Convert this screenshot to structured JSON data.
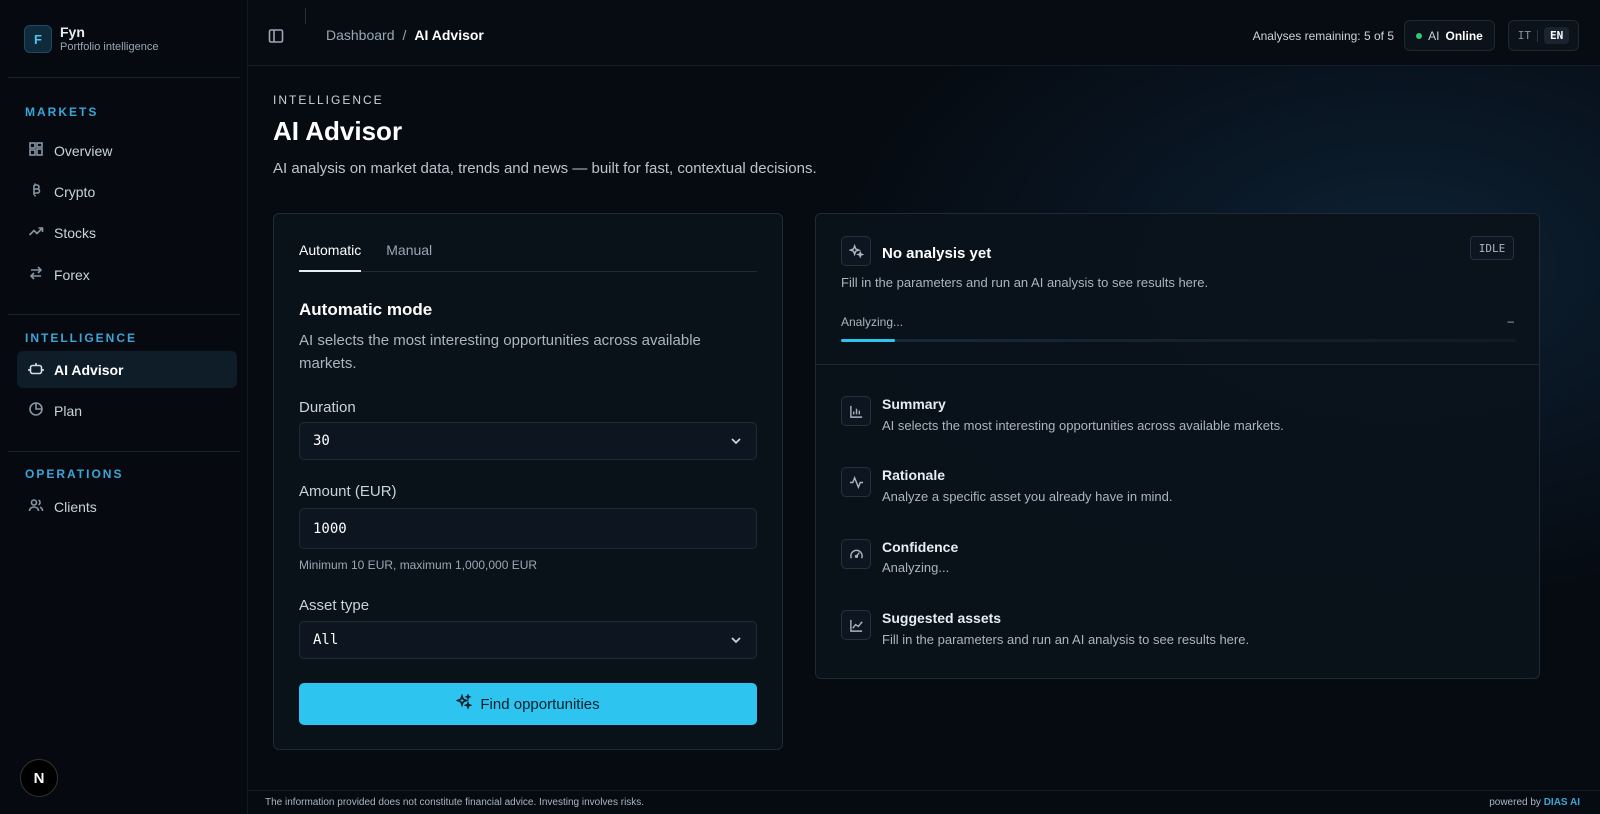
{
  "brand": {
    "logo_letter": "F",
    "name": "Fyn",
    "tagline": "Portfolio intelligence"
  },
  "sidebar": {
    "sections": [
      {
        "label": "MARKETS"
      },
      {
        "label": "INTELLIGENCE"
      },
      {
        "label": "OPERATIONS"
      }
    ],
    "items": [
      {
        "label": "Overview",
        "icon": "grid-icon"
      },
      {
        "label": "Crypto",
        "icon": "bitcoin-icon"
      },
      {
        "label": "Stocks",
        "icon": "trend-up-icon"
      },
      {
        "label": "Forex",
        "icon": "swap-icon"
      },
      {
        "label": "AI Advisor",
        "icon": "bot-icon",
        "active": true
      },
      {
        "label": "Plan",
        "icon": "pie-icon"
      },
      {
        "label": "Clients",
        "icon": "users-icon"
      }
    ],
    "badge": "N"
  },
  "header": {
    "breadcrumb": {
      "root": "Dashboard",
      "sep": "/",
      "current": "AI Advisor"
    },
    "analyses_remaining": "Analyses remaining: 5 of 5",
    "ai_status": {
      "prefix": "AI",
      "status": "Online",
      "color": "#34c76f"
    },
    "languages": {
      "other": "IT",
      "selected": "EN"
    }
  },
  "page": {
    "eyebrow": "INTELLIGENCE",
    "title": "AI Advisor",
    "subtitle": "AI analysis on market data, trends and news — built for fast, contextual decisions."
  },
  "form": {
    "tabs": [
      {
        "label": "Automatic",
        "active": true
      },
      {
        "label": "Manual"
      }
    ],
    "mode_title": "Automatic mode",
    "mode_desc": "AI selects the most interesting opportunities across available markets.",
    "duration": {
      "label": "Duration",
      "value": "30"
    },
    "amount": {
      "label": "Amount (EUR)",
      "value": "1000",
      "hint": "Minimum 10 EUR, maximum 1,000,000 EUR"
    },
    "asset_type": {
      "label": "Asset type",
      "value": "All"
    },
    "submit_label": "Find opportunities",
    "accent": "#2ec4f0"
  },
  "result": {
    "title": "No analysis yet",
    "subtitle": "Fill in the parameters and run an AI analysis to see results here.",
    "status_badge": "IDLE",
    "progress": {
      "label": "Analyzing...",
      "value": "–",
      "fraction": 0.08
    },
    "sections": [
      {
        "title": "Summary",
        "text": "AI selects the most interesting opportunities across available markets.",
        "icon": "bar-chart-icon"
      },
      {
        "title": "Rationale",
        "text": "Analyze a specific asset you already have in mind.",
        "icon": "pulse-icon"
      },
      {
        "title": "Confidence",
        "text": "Analyzing...",
        "icon": "gauge-icon"
      },
      {
        "title": "Suggested assets",
        "text": "Fill in the parameters and run an AI analysis to see results here.",
        "icon": "line-chart-icon"
      }
    ]
  },
  "footer": {
    "disclaimer": "The information provided does not constitute financial advice. Investing involves risks.",
    "powered_prefix": "powered by",
    "powered_brand": "DIAS AI"
  }
}
